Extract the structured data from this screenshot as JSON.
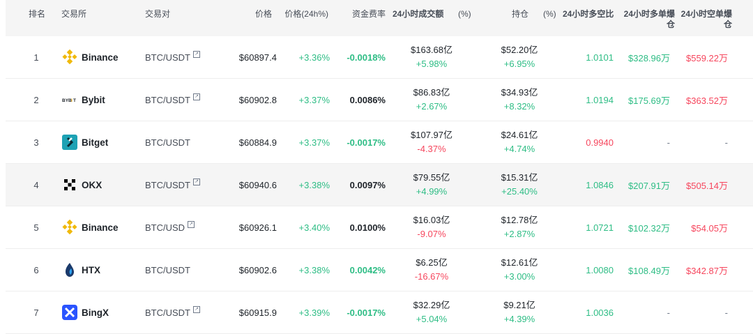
{
  "headers": {
    "rank": "排名",
    "exchange": "交易所",
    "pair": "交易对",
    "price": "价格",
    "change": "价格(24h%)",
    "funding": "资金费率",
    "volume": "24小时成交额",
    "volume_pct": "(%)",
    "oi": "持仓",
    "oi_pct": "(%)",
    "ratio": "24小时多空比",
    "liq_long_1": "24小时多单爆",
    "liq_long_2": "仓",
    "liq_short_1": "24小时空单爆",
    "liq_short_2": "仓"
  },
  "rows": [
    {
      "rank": "1",
      "exchange": "Binance",
      "logo": "binance-logo",
      "pair": "BTC/USDT",
      "pair_link": true,
      "price": "$60897.4",
      "change": "+3.36%",
      "funding": "-0.0018%",
      "funding_dir": "up",
      "volume": "$163.68亿",
      "volume_chg": "+5.98%",
      "volume_dir": "up",
      "oi": "$52.20亿",
      "oi_chg": "+6.95%",
      "oi_dir": "up",
      "ratio": "1.0101",
      "ratio_dir": "up",
      "liq_long": "$328.96万",
      "liq_short": "$559.22万"
    },
    {
      "rank": "2",
      "exchange": "Bybit",
      "logo": "bybit-logo",
      "pair": "BTC/USDT",
      "pair_link": true,
      "price": "$60902.8",
      "change": "+3.37%",
      "funding": "0.0086%",
      "funding_dir": "neu",
      "volume": "$86.83亿",
      "volume_chg": "+2.67%",
      "volume_dir": "up",
      "oi": "$34.93亿",
      "oi_chg": "+8.32%",
      "oi_dir": "up",
      "ratio": "1.0194",
      "ratio_dir": "up",
      "liq_long": "$175.69万",
      "liq_short": "$363.52万"
    },
    {
      "rank": "3",
      "exchange": "Bitget",
      "logo": "bitget-logo",
      "pair": "BTC/USDT",
      "pair_link": false,
      "price": "$60884.9",
      "change": "+3.37%",
      "funding": "-0.0017%",
      "funding_dir": "up",
      "volume": "$107.97亿",
      "volume_chg": "-4.37%",
      "volume_dir": "down",
      "oi": "$24.61亿",
      "oi_chg": "+4.74%",
      "oi_dir": "up",
      "ratio": "0.9940",
      "ratio_dir": "down",
      "liq_long": "-",
      "liq_short": "-"
    },
    {
      "rank": "4",
      "exchange": "OKX",
      "logo": "okx-logo",
      "pair": "BTC/USDT",
      "pair_link": true,
      "price": "$60940.6",
      "change": "+3.38%",
      "funding": "0.0097%",
      "funding_dir": "neu",
      "volume": "$79.55亿",
      "volume_chg": "+4.99%",
      "volume_dir": "up",
      "oi": "$15.31亿",
      "oi_chg": "+25.40%",
      "oi_dir": "up",
      "ratio": "1.0846",
      "ratio_dir": "up",
      "liq_long": "$207.91万",
      "liq_short": "$505.14万"
    },
    {
      "rank": "5",
      "exchange": "Binance",
      "logo": "binance-logo",
      "pair": "BTC/USD",
      "pair_link": true,
      "price": "$60926.1",
      "change": "+3.40%",
      "funding": "0.0100%",
      "funding_dir": "neu",
      "volume": "$16.03亿",
      "volume_chg": "-9.07%",
      "volume_dir": "down",
      "oi": "$12.78亿",
      "oi_chg": "+2.87%",
      "oi_dir": "up",
      "ratio": "1.0721",
      "ratio_dir": "up",
      "liq_long": "$102.32万",
      "liq_short": "$54.05万"
    },
    {
      "rank": "6",
      "exchange": "HTX",
      "logo": "htx-logo",
      "pair": "BTC/USDT",
      "pair_link": false,
      "price": "$60902.6",
      "change": "+3.38%",
      "funding": "0.0042%",
      "funding_dir": "up",
      "volume": "$6.25亿",
      "volume_chg": "-16.67%",
      "volume_dir": "down",
      "oi": "$12.61亿",
      "oi_chg": "+3.00%",
      "oi_dir": "up",
      "ratio": "1.0080",
      "ratio_dir": "up",
      "liq_long": "$108.49万",
      "liq_short": "$342.87万"
    },
    {
      "rank": "7",
      "exchange": "BingX",
      "logo": "bingx-logo",
      "pair": "BTC/USDT",
      "pair_link": true,
      "price": "$60915.9",
      "change": "+3.39%",
      "funding": "-0.0017%",
      "funding_dir": "up",
      "volume": "$32.29亿",
      "volume_chg": "+5.04%",
      "volume_dir": "up",
      "oi": "$9.21亿",
      "oi_chg": "+4.39%",
      "oi_dir": "up",
      "ratio": "1.0036",
      "ratio_dir": "up",
      "liq_long": "-",
      "liq_short": "-"
    }
  ],
  "highlighted_row": "4",
  "colors": {
    "up": "#2ebd85",
    "down": "#f6465d",
    "header_bg": "#f5f5f5"
  }
}
